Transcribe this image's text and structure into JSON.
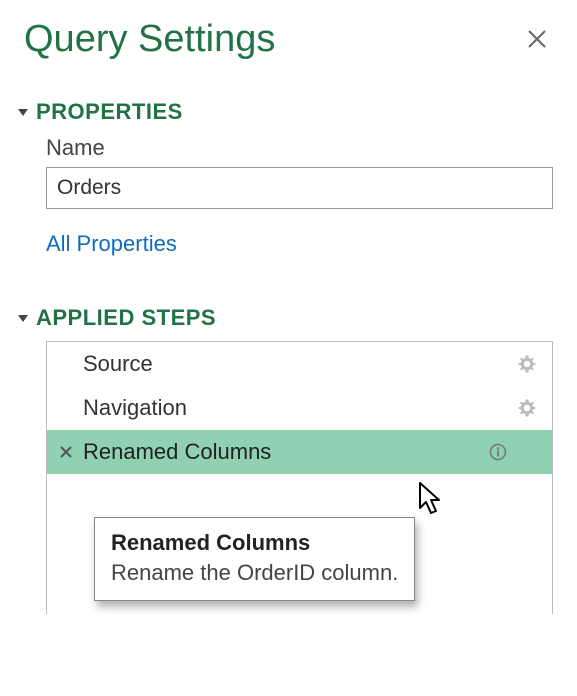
{
  "header": {
    "title": "Query Settings",
    "close_label": "✕"
  },
  "properties": {
    "section_title": "PROPERTIES",
    "name_label": "Name",
    "name_value": "Orders",
    "all_properties_link": "All Properties"
  },
  "applied_steps": {
    "section_title": "APPLIED STEPS",
    "steps": [
      {
        "label": "Source",
        "has_gear": true,
        "selected": false,
        "has_delete": false,
        "has_info": false
      },
      {
        "label": "Navigation",
        "has_gear": true,
        "selected": false,
        "has_delete": false,
        "has_info": false
      },
      {
        "label": "Renamed Columns",
        "has_gear": false,
        "selected": true,
        "has_delete": true,
        "has_info": true
      }
    ]
  },
  "tooltip": {
    "title": "Renamed Columns",
    "body": "Rename the OrderID column."
  }
}
